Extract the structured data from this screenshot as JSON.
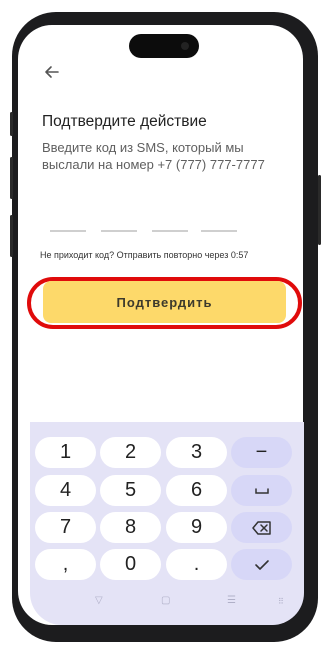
{
  "screen": {
    "title": "Подтвердите действие",
    "subtitle": "Введите код из SMS, который мы выслали на номер +7 (777) 777-7777",
    "resend_text": "Не приходит код? Отправить повторно через 0:57",
    "confirm_label": "Подтвердить",
    "code_slots": 4
  },
  "keyboard": {
    "rows": [
      [
        "1",
        "2",
        "3",
        "−"
      ],
      [
        "4",
        "5",
        "6",
        "␣"
      ],
      [
        "7",
        "8",
        "9",
        "⌫"
      ],
      [
        ",",
        "0",
        ".",
        "✓"
      ]
    ]
  },
  "colors": {
    "accent": "#fdd96a",
    "highlight": "#e00b0b",
    "keyboard_bg": "#e4e3f6",
    "function_key": "#d7d7f7"
  },
  "icons": {
    "back": "arrow-left-icon",
    "nav_back": "triangle-down-icon",
    "nav_home": "circle-icon",
    "nav_recents": "menu-icon",
    "nav_keyboard": "keyboard-icon"
  }
}
